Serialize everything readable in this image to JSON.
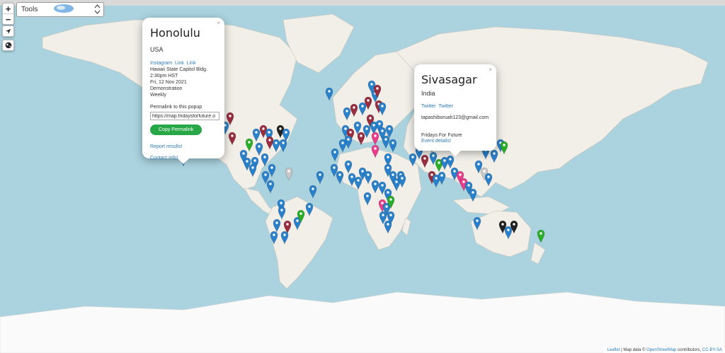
{
  "controls": {
    "zoom_in": "+",
    "zoom_out": "−",
    "tools_label": "Tools"
  },
  "popup_honolulu": {
    "close": "×",
    "city": "Honolulu",
    "country": "USA",
    "links": [
      "Instagram",
      "Link",
      "Link"
    ],
    "location": "Hawaii State Capitol Bldg.",
    "time": "2:30pm HST",
    "date": "Fri, 12 Nov 2021",
    "type": "Demonstration",
    "frequency": "Weekly",
    "permalink_label": "Permalink to this popup",
    "permalink_value": "https://map.fridaysforfuture.o",
    "copy_button": "Copy Permalink",
    "report": "Report results!",
    "contact": "Contact info!"
  },
  "popup_sivasagar": {
    "close": "×",
    "city": "Sivasagar",
    "country": "India",
    "links": [
      "Twitter",
      "Twitter"
    ],
    "email": "tapashiboruah123@gmail.com",
    "organization": "Fridays For Future",
    "details": "Event details!"
  },
  "attribution": {
    "leaflet": "Leaflet",
    "sep1": " | Map data © ",
    "osm": "OpenStreetMap",
    "contributors": " contributors, ",
    "license": "CC-BY-SA"
  },
  "colors": {
    "ocean": "#aad3df",
    "land": "#f2efe9",
    "ice": "#fafafa",
    "pin_blue": "#2a81cb",
    "pin_red": "#982e40",
    "pin_green": "#2aad27",
    "pin_pink": "#e83e8c",
    "pin_black": "#222222",
    "pin_grey": "#c8c8c8",
    "button_green": "#27a745"
  }
}
